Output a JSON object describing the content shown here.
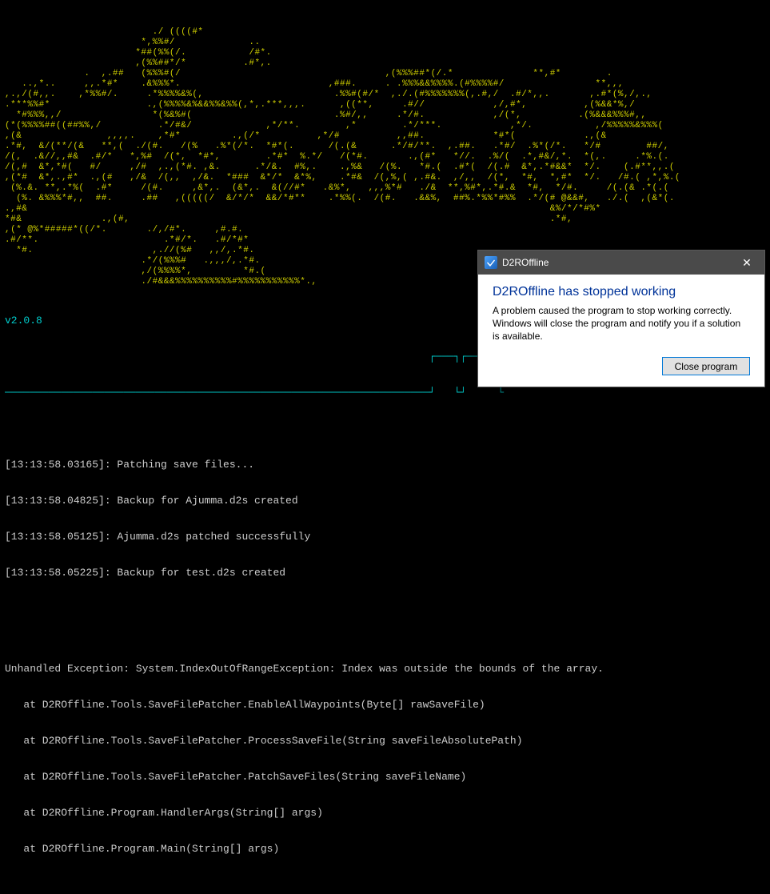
{
  "ascii_art": "                          ./ ((((#*\n                        *,%%#/             ..\n                       *##(%%(/.           /#*.\n                       ,(%%##*/*          .#*,.\n              .  ,.##   (%%%#(/                                    ,(%%%##*(/.*              **,#*        .\n   ..,*..     ,,.*#*    .&%%%*.                          ,###.     . .%%%&&%%%%.(#%%%%#/                **,,,\n,.,/(#,,.    ,*%%#/.     .*%%%%&%(,                       .%%#(#/*  ,./.(#%%%%%%%(,.#,/  .#/*,,.       ,.#*(%,/,.,\n.***%%#*                 .,(%%%%&%&&%%&%%(,*,.***,,,.      ,((**,     .#//            ,/,#*,          ,(%&&*%,/\n  *#%%%,,/                *(%&%#(                         .%#/,,     .*/#.            ,/(*,          .(%&&&%%%#,,\n(*(%%%%##((##%%,/          .*/#&/             ,*/**.        ,*        .*/***.            ,*/.           ,/%%%%%&%%%(\n,(&               ,,,,.    ,*#*         .,(/*          ,*/#          ,,##.            *#*(            .,(&\n.*#,  &/(**/(&   **,(  ./(#.   /(%   .%*(/*.  *#*(.      /(.(&      .*/#/**.  ,.##.   .*#/  .%*(/*.   */#        ##/,\n/(,  .&//,,#&  .#/*   *,%#  /(*,  *#*,        .*#*  %.*/   /(*#.       .,(#*   *//.  .%/(  .*,#&/,*.  *(,.     .*%.(.\n/(,#  &*,*#(   #/     ,/#  ,.,(*#. ,&.      .*/&.  #%,.    .,%&   /(%.   *#.(  .#*(  /(.#  &*,.*#&&*  */.    (.#**,,.(\n,(*#  &*,.,#*  .,(#   ,/&  /(,,  ,/&.  *###  &*/*  &*%,    .*#&  /(,%,( ,.#&.  ,/,,  /(*,  *#,  *,#*  */.   /#.( ,*,%.(\n (%.&. **,.*%(  .#*     /(#.     ,&*,.  (&*,.  &(//#*   .&%*,   ,,,%*#   ./&  **,%#*,.*#.&  *#,  */#.     /(.(& .*(.(\n  (%. &%%%*#,,  ##.     .##   ,(((((/  &/*/*  &&/*#**    .*%%(.  /(#.   .&&%,  ##%.*%%*#%%  .*/(# @&&#,   ./.(  ,(&*(.\n.,#&                                                                                            &%/*/*#%*\n*#&              .,(#,                                                                          .*#,\n,(* @%*#####*((/*.       ./,/#*.     ,#.#.\n.#/**.                      .*#/*.   .#/*#*\n  *#.                     ,.//(%#   ,,/,.*#.\n                        .*/(%%%#   .,,,/,.*#.\n                        ,/(%%%%*,         *#.(\n                        ./#&&&%%%%%%%%%%#%%%%%%%%%%%*.,",
  "version": "v2.0.8",
  "divider_top": "                                                                    ┌───┐┌─────┐",
  "divider_bottom": "────────────────────────────────────────────────────────────────────┘   └┘     └",
  "log": [
    "[13:13:58.03165]: Patching save files...",
    "[13:13:58.04825]: Backup for Ajumma.d2s created",
    "[13:13:58.05125]: Ajumma.d2s patched successfully",
    "[13:13:58.05225]: Backup for test.d2s created"
  ],
  "error": [
    "Unhandled Exception: System.IndexOutOfRangeException: Index was outside the bounds of the array.",
    "   at D2ROffline.Tools.SaveFilePatcher.EnableAllWaypoints(Byte[] rawSaveFile)",
    "   at D2ROffline.Tools.SaveFilePatcher.ProcessSaveFile(String saveFileAbsolutePath)",
    "   at D2ROffline.Tools.SaveFilePatcher.PatchSaveFiles(String saveFileName)",
    "   at D2ROffline.Program.HandlerArgs(String[] args)",
    "   at D2ROffline.Program.Main(String[] args)"
  ],
  "dialog": {
    "title": "D2ROffline",
    "heading": "D2ROffline has stopped working",
    "body": "A problem caused the program to stop working correctly. Windows will close the program and notify you if a solution is available.",
    "close_label": "Close program"
  }
}
